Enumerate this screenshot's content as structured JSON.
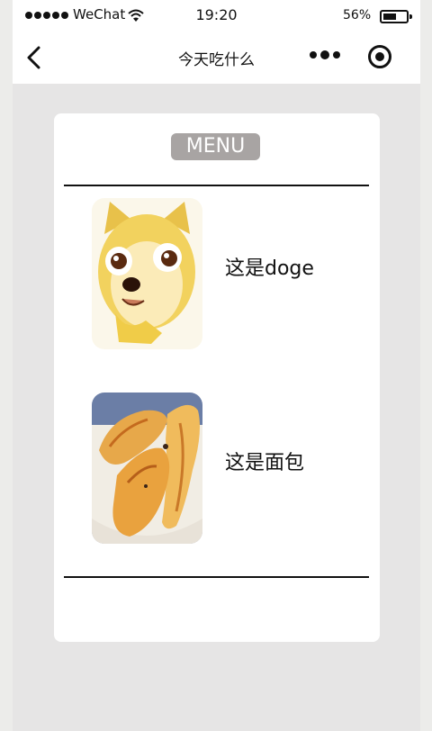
{
  "status_bar": {
    "carrier": "WeChat",
    "time": "19:20",
    "battery_percent": "56%",
    "battery_level": 0.56,
    "icons": [
      "signal-dots-icon",
      "wifi-icon",
      "battery-icon"
    ]
  },
  "navbar": {
    "title": "今天吃什么",
    "icons": [
      "back-chevron-icon",
      "more-dots-icon",
      "target-circle-icon"
    ]
  },
  "menu": {
    "button_label": "MENU",
    "items": [
      {
        "label": "这是doge",
        "image": "doge-image"
      },
      {
        "label": "这是面包",
        "image": "bread-image"
      }
    ]
  },
  "colors": {
    "page_bg": "#e6e5e5",
    "card_bg": "#ffffff",
    "menu_button_bg": "#a8a4a3",
    "text": "#111111"
  }
}
